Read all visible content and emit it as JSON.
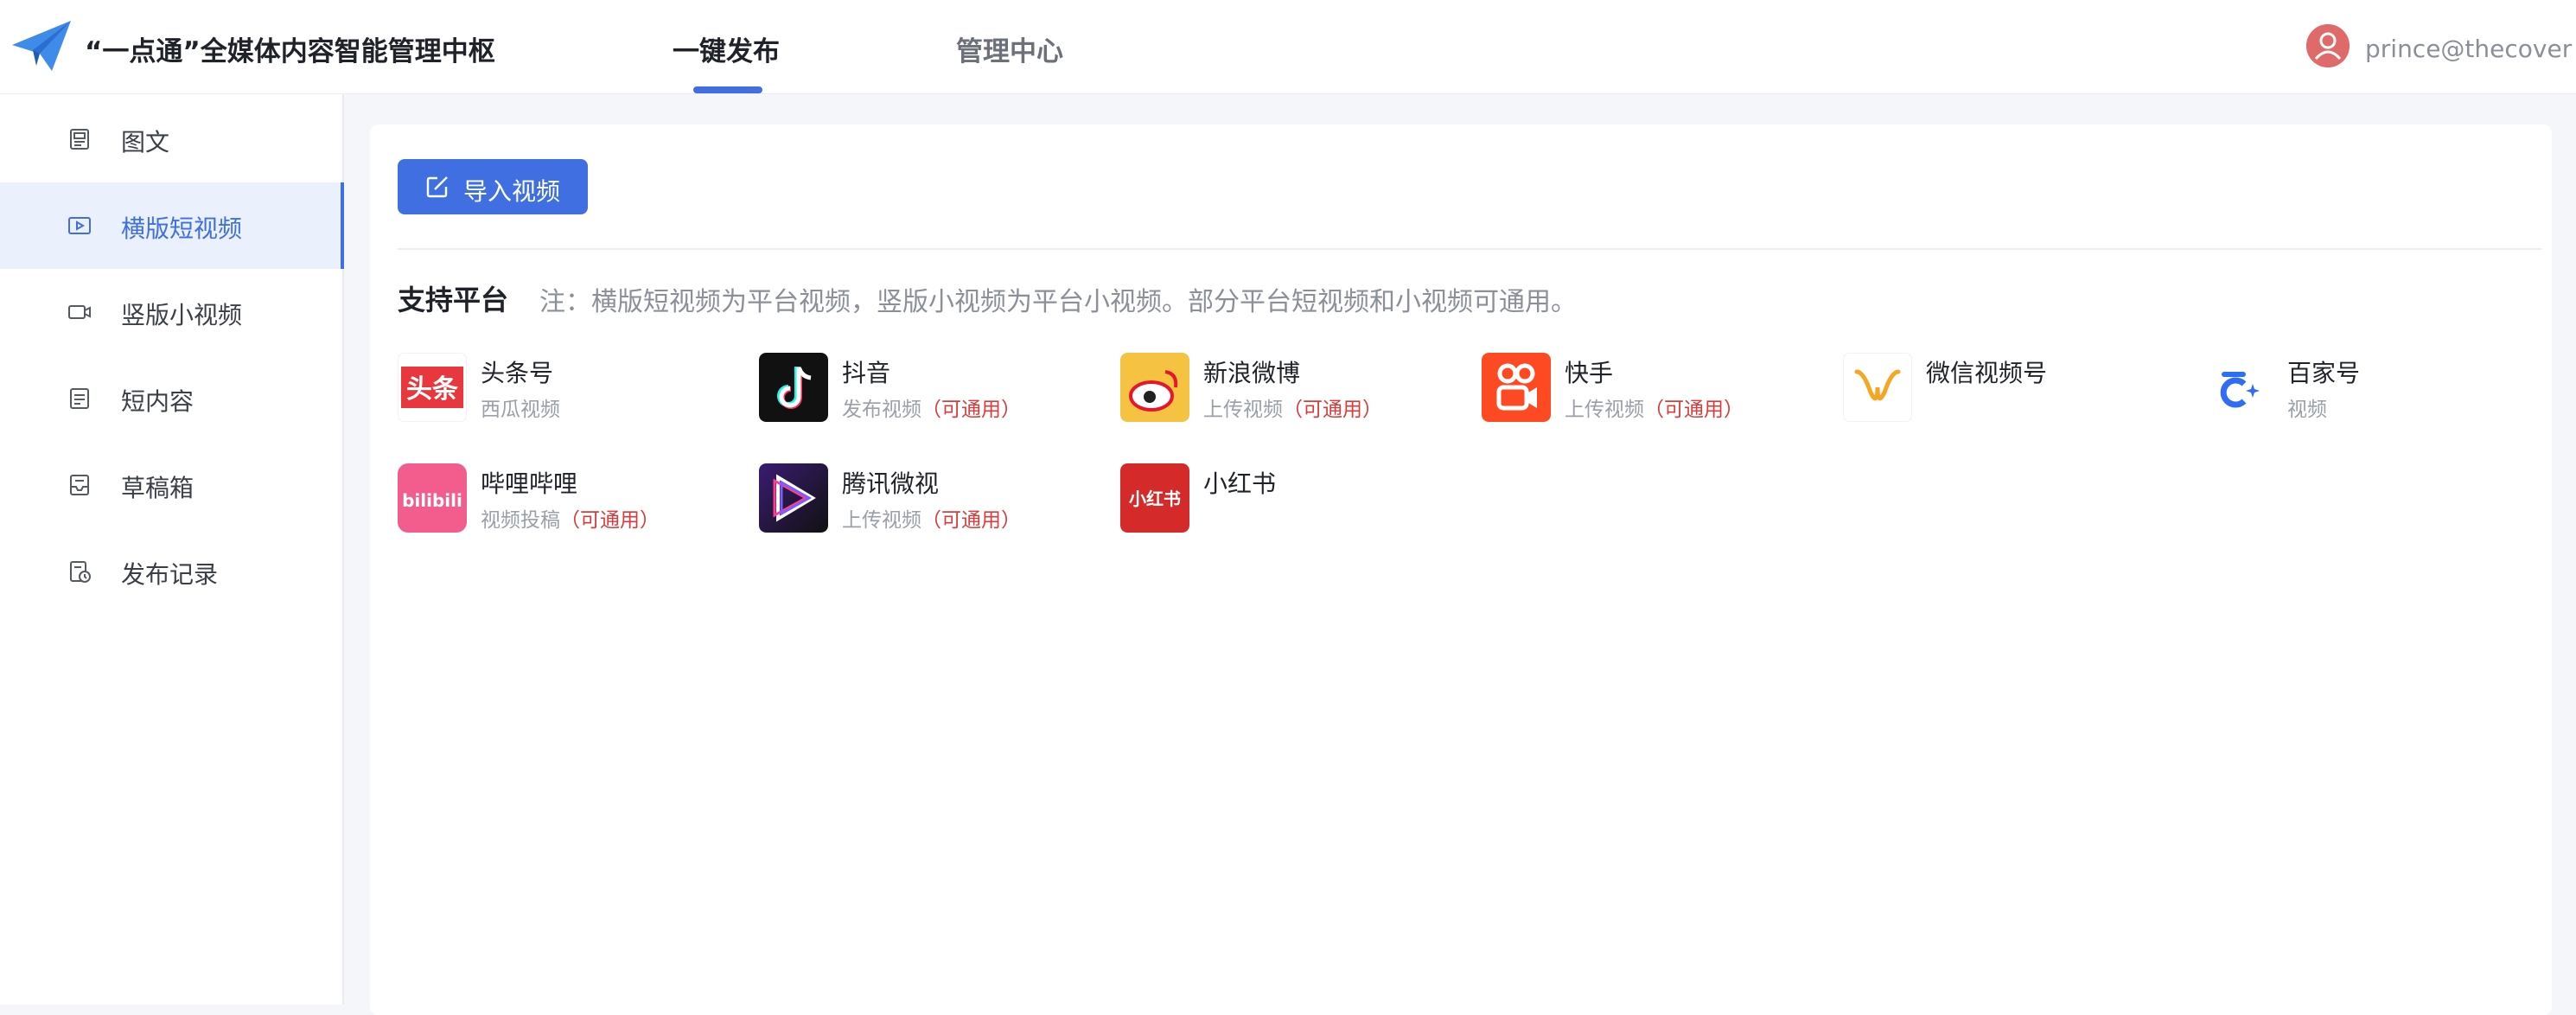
{
  "header": {
    "app_title": "“一点通”全媒体内容智能管理中枢",
    "tabs": [
      {
        "label": "一键发布",
        "active": true
      },
      {
        "label": "管理中心",
        "active": false
      }
    ],
    "user": "prince@thecover"
  },
  "sidebar": {
    "items": [
      {
        "label": "图文",
        "icon": "article-icon"
      },
      {
        "label": "横版短视频",
        "icon": "video-icon",
        "active": true
      },
      {
        "label": "竖版小视频",
        "icon": "camera-icon"
      },
      {
        "label": "短内容",
        "icon": "note-icon"
      },
      {
        "label": "草稿箱",
        "icon": "drafts-icon"
      },
      {
        "label": "发布记录",
        "icon": "history-icon"
      }
    ]
  },
  "main": {
    "import_button": "导入视频",
    "section_title": "支持平台",
    "section_note": "注：横版短视频为平台视频，竖版小视频为平台小视频。部分平台短视频和小视频可通用。",
    "platforms": [
      {
        "name": "头条号",
        "sub": "西瓜视频",
        "tag": ""
      },
      {
        "name": "抖音",
        "sub": "发布视频",
        "tag": "（可通用）"
      },
      {
        "name": "新浪微博",
        "sub": "上传视频",
        "tag": "（可通用）"
      },
      {
        "name": "快手",
        "sub": "上传视频",
        "tag": "（可通用）"
      },
      {
        "name": "微信视频号",
        "sub": "",
        "tag": ""
      },
      {
        "name": "百家号",
        "sub": "视频",
        "tag": ""
      },
      {
        "name": "哔哩哔哩",
        "sub": "视频投稿",
        "tag": "（可通用）"
      },
      {
        "name": "腾讯微视",
        "sub": "上传视频",
        "tag": "（可通用）"
      },
      {
        "name": "小红书",
        "sub": "",
        "tag": ""
      }
    ],
    "icon_text": {
      "toutiao": "头条",
      "bilibili": "bilibili",
      "xhs": "小红书"
    }
  },
  "colors": {
    "accent": "#3f6fe0",
    "tag": "#d83b3b",
    "muted": "#8a8f98"
  }
}
